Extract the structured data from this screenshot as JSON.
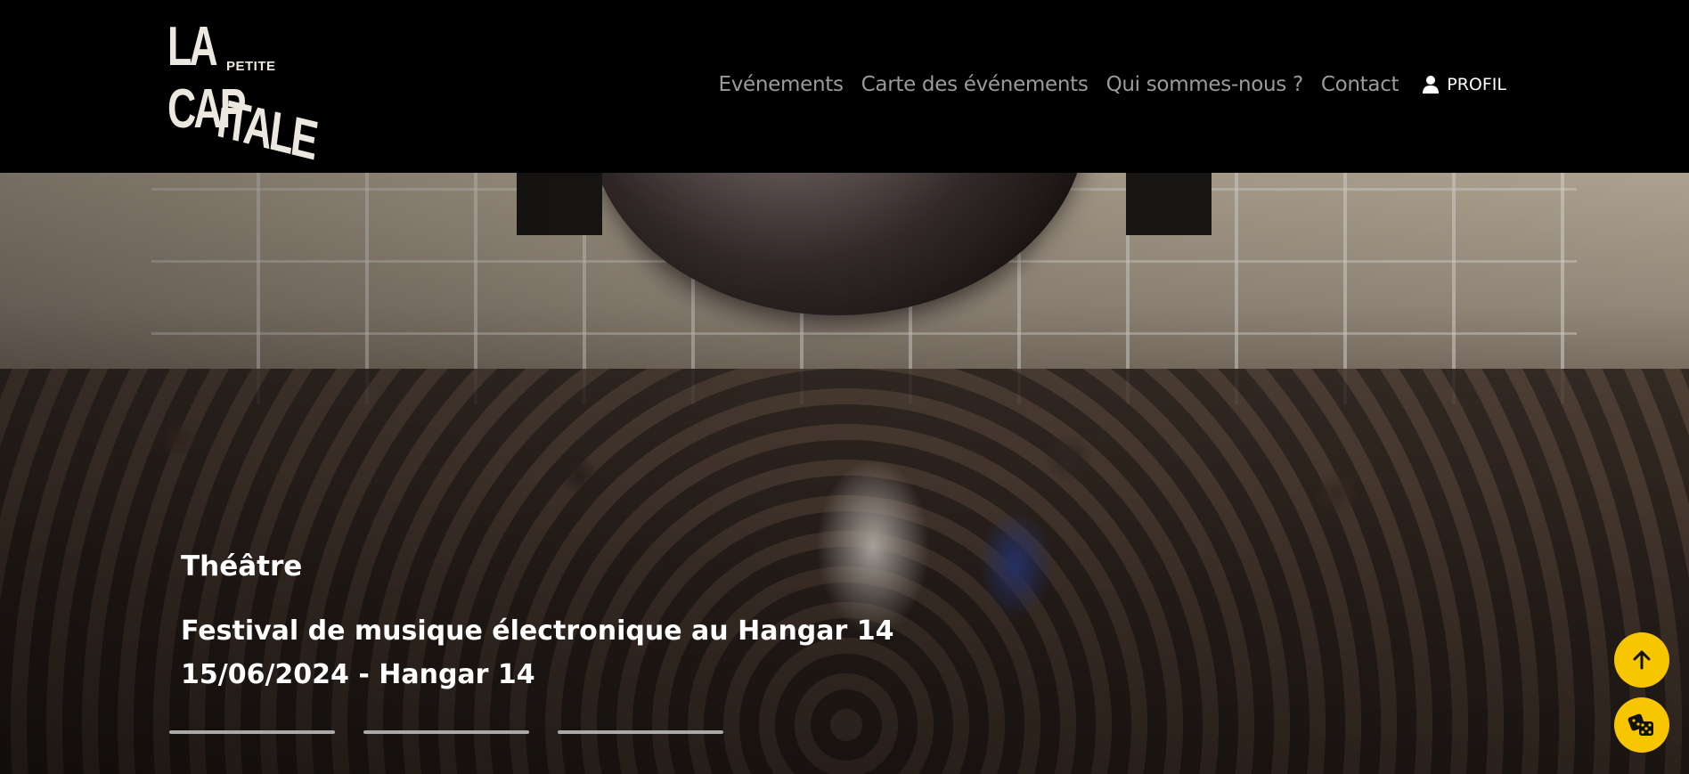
{
  "brand": {
    "line1": "LA",
    "small": "PETITE",
    "line2": "CAP",
    "line3": "iTALE"
  },
  "nav": {
    "items": [
      {
        "label": "Evénements"
      },
      {
        "label": "Carte des événements"
      },
      {
        "label": "Qui sommes-nous ?"
      },
      {
        "label": "Contact"
      }
    ],
    "profile_label": "PROFIL",
    "profile_icon": "user-icon"
  },
  "hero": {
    "category": "Théâtre",
    "title": "Festival de musique électronique au Hangar 14",
    "date_place": "15/06/2024 - Hangar 14",
    "slide_count": 3
  },
  "floating_buttons": [
    {
      "icon": "arrow-up-icon",
      "color": "#f7c600"
    },
    {
      "icon": "dice-icon",
      "color": "#f7c600"
    }
  ],
  "colors": {
    "accent": "#f7c600",
    "header_bg": "#000000",
    "nav_text": "#9b9b9b"
  }
}
